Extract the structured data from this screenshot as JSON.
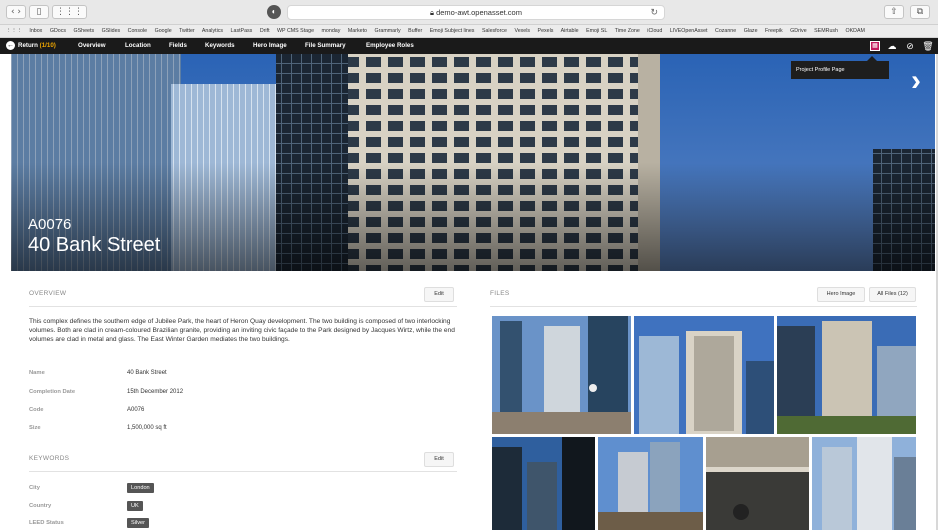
{
  "browser": {
    "url": "demo-awt.openasset.com",
    "bookmarks": [
      "Inbox",
      "GDocs",
      "GSheets",
      "GSlides",
      "Console",
      "Google",
      "Twitter",
      "Analytics",
      "LastPass",
      "Drift",
      "WP CMS Stage",
      "monday",
      "Marketo",
      "Grammarly",
      "Buffer",
      "Emoji Subject lines",
      "Salesforce",
      "Vexels",
      "Pexels",
      "Airtable",
      "Emoji SL",
      "Time Zone",
      "iCloud",
      "LIVEOpenAsset",
      "Cozanne",
      "Glaze",
      "Freepik",
      "GDrive",
      "SEMRush",
      "OKDAM"
    ]
  },
  "nav": {
    "return_label": "Return",
    "return_count": "(1/10)",
    "items": [
      "Overview",
      "Location",
      "Fields",
      "Keywords",
      "Hero Image",
      "File Summary",
      "Employee Roles"
    ],
    "tooltip": "Project Profile Page"
  },
  "hero": {
    "code": "A0076",
    "name": "40 Bank Street"
  },
  "overview": {
    "heading": "OVERVIEW",
    "edit_label": "Edit",
    "description": "This complex defines the southern edge of Jubilee Park, the heart of Heron Quay development. The two building is composed of two interlocking volumes. Both are clad in cream-coloured Brazilian granite, providing an inviting civic façade to the Park designed by Jacques Wirtz, while the end volumes are clad in metal and glass. The East Winter Garden mediates the two buildings.",
    "fields": [
      {
        "label": "Name",
        "value": "40 Bank Street"
      },
      {
        "label": "Completion Date",
        "value": "15th December 2012"
      },
      {
        "label": "Code",
        "value": "A0076"
      },
      {
        "label": "Size",
        "value": "1,500,000 sq ft"
      }
    ]
  },
  "keywords": {
    "heading": "KEYWORDS",
    "edit_label": "Edit",
    "fields": [
      {
        "label": "City",
        "value": "London"
      },
      {
        "label": "Country",
        "value": "UK"
      },
      {
        "label": "LEED Status",
        "value": "Silver"
      }
    ]
  },
  "files": {
    "heading": "FILES",
    "hero_image_label": "Hero Image",
    "all_files_label": "All Files (12)"
  },
  "colors": {
    "nav_bg": "#1a1a1a",
    "accent": "#f2a800",
    "active_icon": "#c2185b"
  }
}
